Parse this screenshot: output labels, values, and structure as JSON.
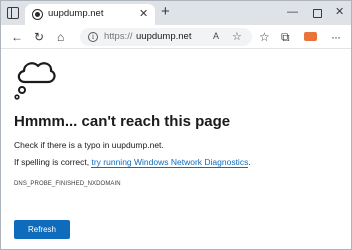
{
  "tab": {
    "title": "uupdump.net",
    "close_glyph": "✕",
    "new_tab_glyph": "+"
  },
  "window_controls": {
    "minimize": "—",
    "close": "✕"
  },
  "toolbar": {
    "back_glyph": "←",
    "refresh_glyph": "↻",
    "home_glyph": "⌂",
    "url_prefix": "https://",
    "url_host": "uupdump.net",
    "read_aloud_glyph": "A",
    "add_favorite_glyph": "☆",
    "favorites_glyph": "☆",
    "collections_glyph": "⧉",
    "menu_glyph": "···"
  },
  "error": {
    "headline": "Hmmm... can't reach this page",
    "line1": "Check if there is a typo in uupdump.net.",
    "line2_prefix": "If spelling is correct, ",
    "line2_link": "try running Windows Network Diagnostics",
    "line2_suffix": ".",
    "code": "DNS_PROBE_FINISHED_NXDOMAIN",
    "refresh_button": "Refresh"
  },
  "colors": {
    "accent": "#0f6cbd",
    "extension": "#e8743b"
  }
}
